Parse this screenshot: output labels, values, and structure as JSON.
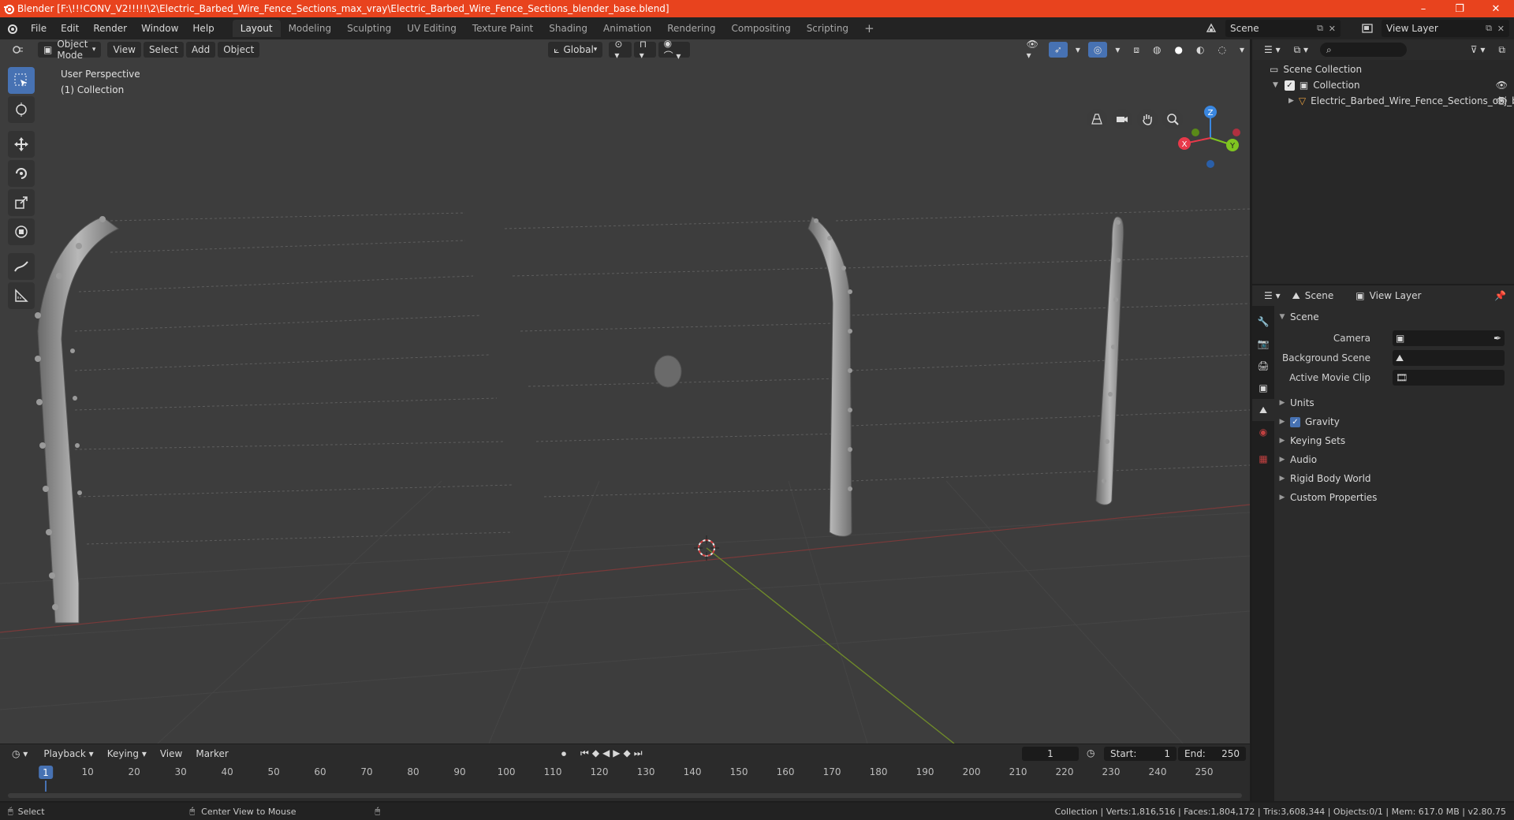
{
  "window": {
    "title": "Blender [F:\\!!!CONV_V2!!!!!\\2\\Electric_Barbed_Wire_Fence_Sections_max_vray\\Electric_Barbed_Wire_Fence_Sections_blender_base.blend]",
    "minimize": "–",
    "maximize": "❐",
    "close": "✕"
  },
  "menu": [
    "File",
    "Edit",
    "Render",
    "Window",
    "Help"
  ],
  "workspaces": [
    "Layout",
    "Modeling",
    "Sculpting",
    "UV Editing",
    "Texture Paint",
    "Shading",
    "Animation",
    "Rendering",
    "Compositing",
    "Scripting"
  ],
  "workspace_add": "+",
  "scene_selector": "Scene",
  "view_layer_selector": "View Layer",
  "viewport": {
    "mode": "Object Mode",
    "menus": [
      "View",
      "Select",
      "Add",
      "Object"
    ],
    "orientation": "Global",
    "perspective_label": "User Perspective",
    "collection_label": "(1) Collection"
  },
  "gizmo": {
    "x": "X",
    "y": "Y",
    "z": "Z"
  },
  "outliner": {
    "root": "Scene Collection",
    "collection": "Collection",
    "object": "Electric_Barbed_Wire_Fence_Sections_obj_b"
  },
  "properties": {
    "tab_scene": "Scene",
    "tab_view_layer": "View Layer",
    "section": "Scene",
    "camera_label": "Camera",
    "background_scene_label": "Background Scene",
    "active_movie_clip_label": "Active Movie Clip",
    "panels": [
      "Units",
      "Gravity",
      "Keying Sets",
      "Audio",
      "Rigid Body World",
      "Custom Properties"
    ]
  },
  "timeline": {
    "menus": [
      "Playback",
      "Keying",
      "View",
      "Marker"
    ],
    "current_frame": "1",
    "start_label": "Start:",
    "start": "1",
    "end_label": "End:",
    "end": "250",
    "ticks": [
      "1",
      "10",
      "20",
      "30",
      "40",
      "50",
      "60",
      "70",
      "80",
      "90",
      "100",
      "110",
      "120",
      "130",
      "140",
      "150",
      "160",
      "170",
      "180",
      "190",
      "200",
      "210",
      "220",
      "230",
      "240",
      "250"
    ]
  },
  "status": {
    "select": "Select",
    "center_view": "Center View to Mouse",
    "stats": "Collection | Verts:1,816,516 | Faces:1,804,172 | Tris:3,608,344 | Objects:0/1 | Mem: 617.0 MB | v2.80.75"
  },
  "colors": {
    "title_bar": "#e8431e",
    "accent": "#4772b3",
    "axis_x": "#e8394a",
    "axis_y": "#7fc420",
    "axis_z": "#3a87e0"
  }
}
